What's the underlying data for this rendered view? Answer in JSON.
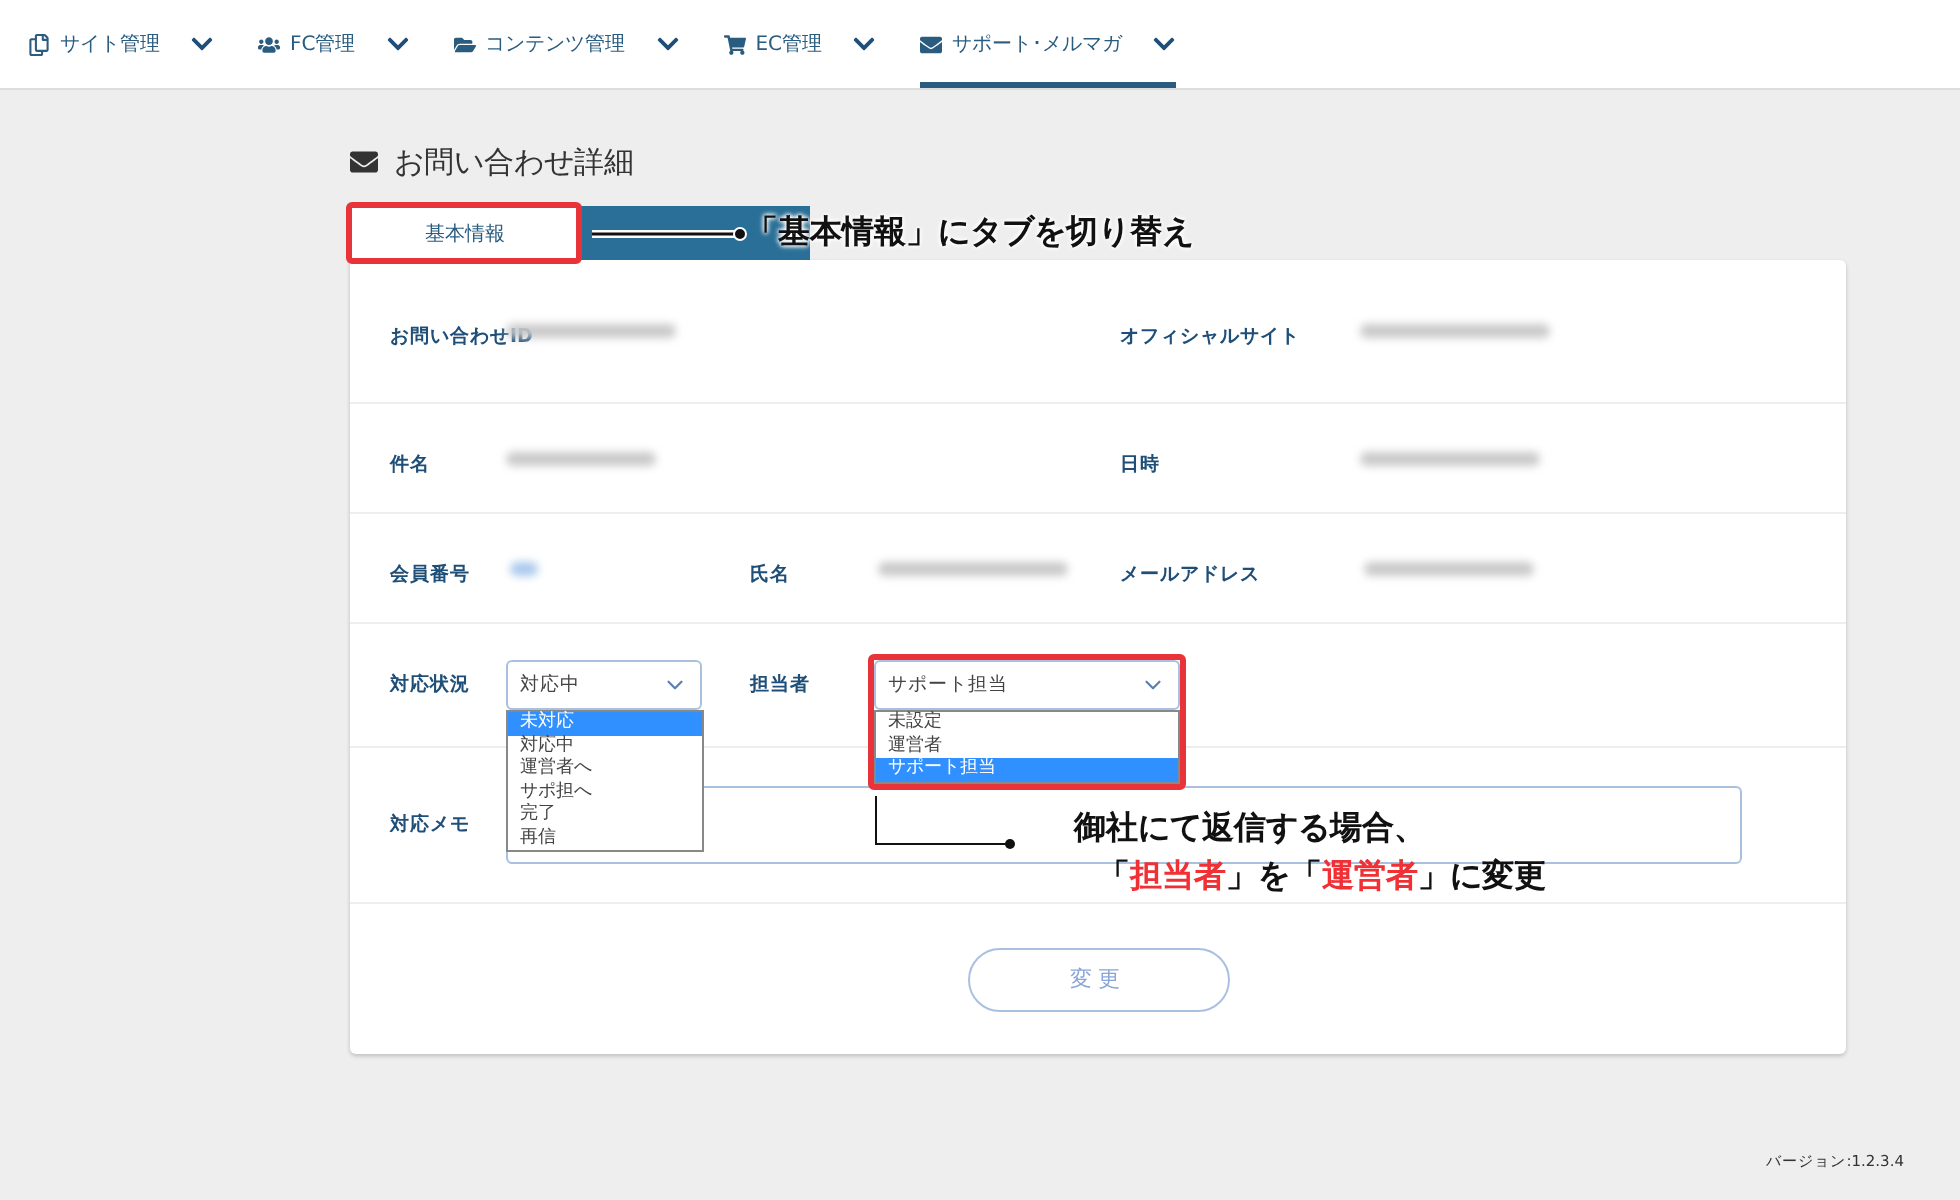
{
  "nav": {
    "items": [
      {
        "label": "サイト管理",
        "selected": false
      },
      {
        "label": "FC管理",
        "selected": false
      },
      {
        "label": "コンテンツ管理",
        "selected": false
      },
      {
        "label": "EC管理",
        "selected": false
      },
      {
        "label": "サポート･メルマガ",
        "selected": true
      }
    ]
  },
  "page_title": "お問い合わせ詳細",
  "tabs": [
    {
      "label": "基本情報",
      "selected": true
    },
    {
      "selected": false
    }
  ],
  "tab_callout": "「基本情報」にタブを切り替え",
  "details": {
    "rows": [
      [
        {
          "label": "お問い合わせID"
        },
        {
          "label": "オフィシャルサイト"
        }
      ],
      [
        {
          "label": "件名"
        },
        {
          "label": "日時"
        }
      ],
      [
        {
          "label": "会員番号"
        },
        {
          "label": "氏名"
        },
        {
          "label": "メールアドレス"
        }
      ]
    ]
  },
  "status": {
    "label": "対応状況",
    "value": "対応中",
    "options": [
      {
        "label": "未対応",
        "highlighted": true
      },
      {
        "label": "対応中",
        "highlighted": false
      },
      {
        "label": "運営者へ",
        "highlighted": false
      },
      {
        "label": "サポ担へ",
        "highlighted": false
      },
      {
        "label": "完了",
        "highlighted": false
      },
      {
        "label": "再信",
        "highlighted": false
      }
    ]
  },
  "assignee": {
    "label": "担当者",
    "value": "サポート担当",
    "options": [
      {
        "label": "未設定",
        "selected": false
      },
      {
        "label": "運営者",
        "selected": false
      },
      {
        "label": "サポート担当",
        "selected": true
      }
    ]
  },
  "memo": {
    "label": "対応メモ"
  },
  "assignee_callout": [
    [
      {
        "text": "御社にて返信する場合、",
        "highlight": false
      }
    ],
    [
      {
        "text": "「",
        "highlight": false
      },
      {
        "text": "担当者",
        "highlight": true
      },
      {
        "text": "」を「",
        "highlight": false
      },
      {
        "text": "運営者",
        "highlight": true
      },
      {
        "text": "」に変更",
        "highlight": false
      }
    ]
  ],
  "submit_button": "変更",
  "version": "バージョン:1.2.3.4"
}
